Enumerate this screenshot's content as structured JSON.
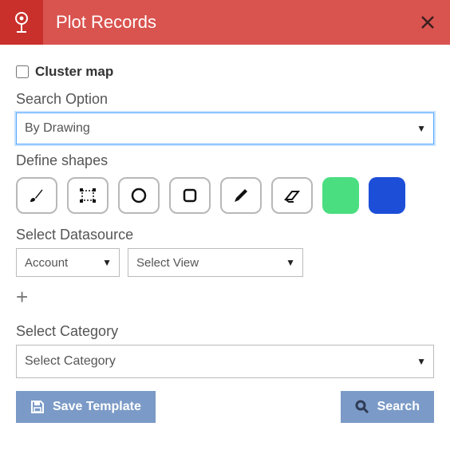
{
  "header": {
    "title": "Plot Records"
  },
  "cluster": {
    "label": "Cluster map",
    "checked": false
  },
  "searchOption": {
    "label": "Search Option",
    "value": "By Drawing"
  },
  "defineShapes": {
    "label": "Define shapes",
    "swatch1": "#4ade80",
    "swatch2": "#1d4ed8"
  },
  "datasource": {
    "label": "Select Datasource",
    "entity": "Account",
    "view": "Select View"
  },
  "category": {
    "label": "Select Category",
    "value": "Select Category"
  },
  "buttons": {
    "save": "Save Template",
    "search": "Search"
  }
}
